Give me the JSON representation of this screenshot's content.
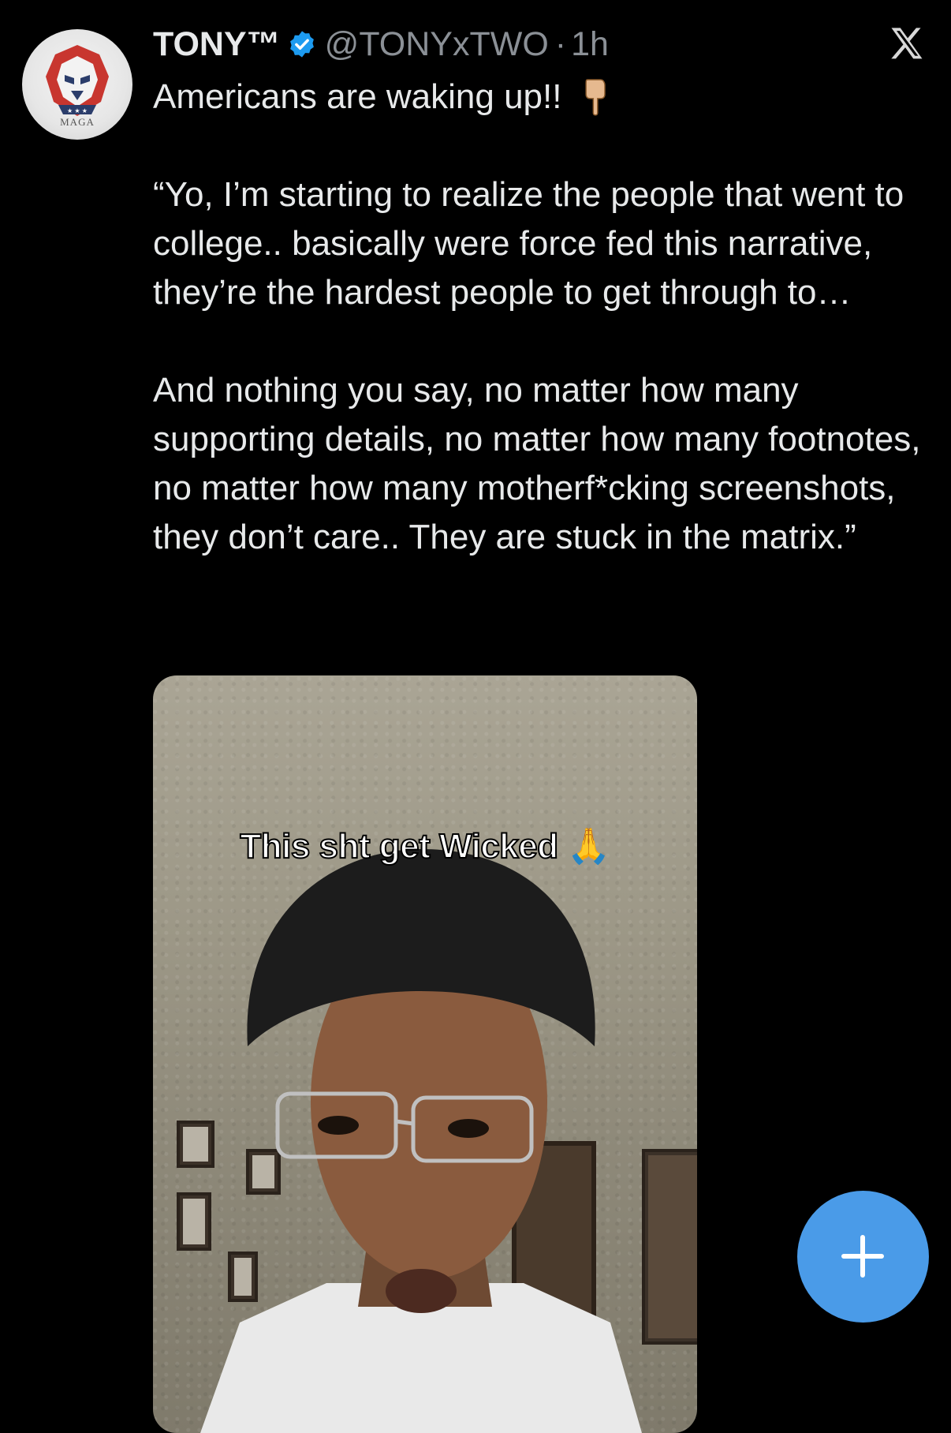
{
  "tweet": {
    "author_name": "TONY™",
    "handle": "@TONYxTWO",
    "separator": "·",
    "time": "1h",
    "avatar_label": "MAGA",
    "text_line1": "Americans are waking up!!",
    "text_body": "“Yo, I’m starting to realize the people that went to college.. basically were force fed this narrative, they’re the hardest people to get through to…\n\nAnd nothing you say, no matter how many supporting details, no matter how many footnotes, no matter how many motherf*cking screenshots, they don’t care.. They are stuck in the matrix.”",
    "emoji_icon": "pointing-down-hand-icon"
  },
  "media": {
    "caption": "This sht get Wicked 🙏"
  },
  "icons": {
    "verified": "verified-badge-icon",
    "brand": "x-logo-icon",
    "compose": "plus-icon"
  },
  "colors": {
    "background": "#000000",
    "text": "#e7e9ea",
    "secondary": "#8b9096",
    "verified": "#1d9bf0",
    "fab": "#4a9be8"
  }
}
